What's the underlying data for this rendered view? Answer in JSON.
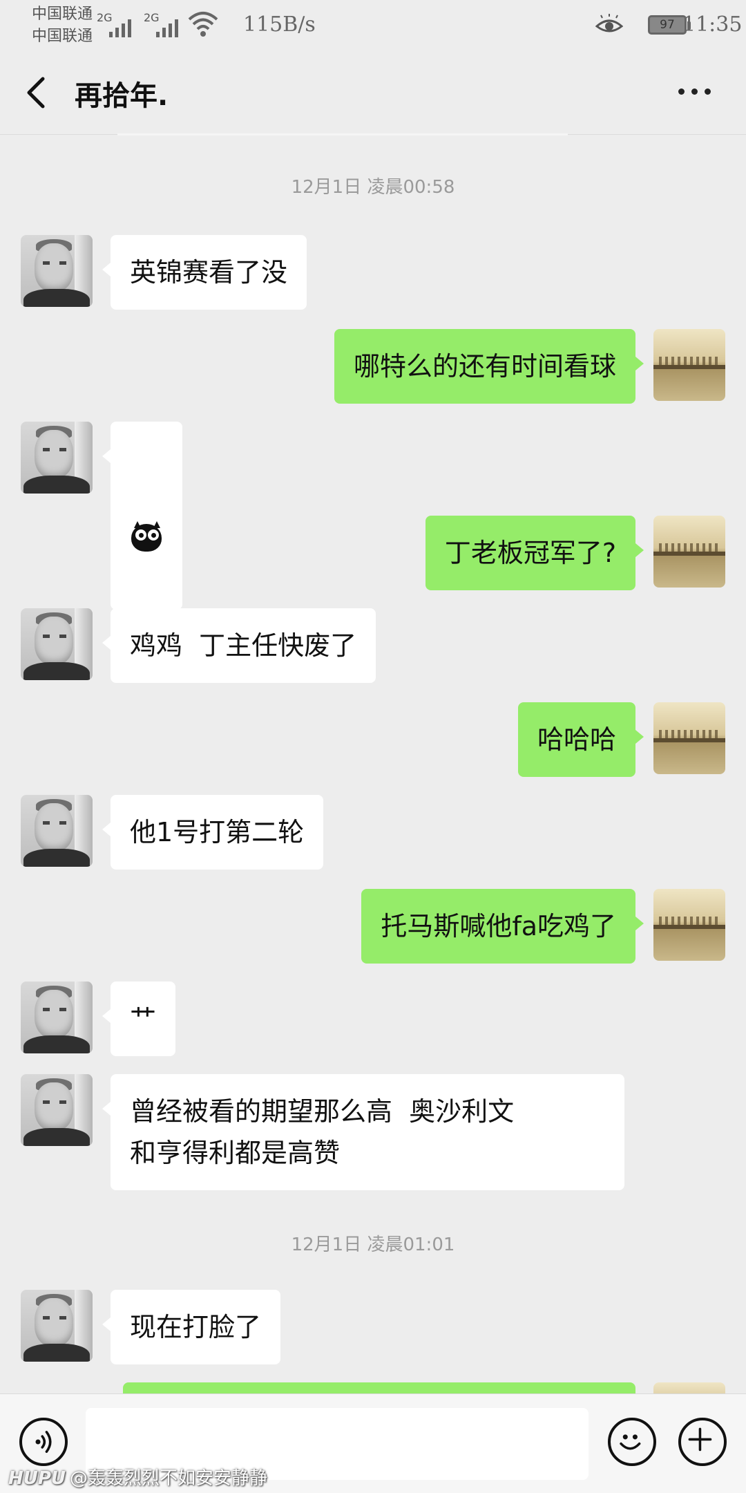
{
  "status_bar": {
    "carrier1": "中国联通",
    "carrier2": "中国联通",
    "sim1_network": "2G",
    "sim2_network": "2G",
    "net_speed": "115B/s",
    "battery_level": "97",
    "time": "11:35"
  },
  "header": {
    "back_icon": "chevron-left-icon",
    "title": "再拾年.",
    "more_icon": "more-dots-icon"
  },
  "messages": {
    "ts1": "12月1日 凌晨00:58",
    "m1": "英锦赛看了没",
    "m2": "哪特么的还有时间看球",
    "m3_sticker": "owl-sticker",
    "m4": "丁老板冠军了?",
    "m5": "鸡鸡  丁主任快废了",
    "m6": "哈哈哈",
    "m7": "他1号打第二轮",
    "m8": "托马斯喊他fa吃鸡了",
    "m9": "艹",
    "m10": "曾经被看的期望那么高  奥沙利文\n和亨得利都是高赞",
    "ts2": "12月1日 凌晨01:01",
    "m11": "现在打脸了"
  },
  "input_bar": {
    "voice_icon": "voice-icon",
    "emoji_icon": "emoji-icon",
    "plus_icon": "plus-icon"
  },
  "watermark": {
    "brand": "HUPU",
    "text": "@轰轰烈烈不如安安静静"
  },
  "colors": {
    "background": "#ededed",
    "outgoing_bubble": "#95ec69",
    "incoming_bubble": "#ffffff"
  }
}
